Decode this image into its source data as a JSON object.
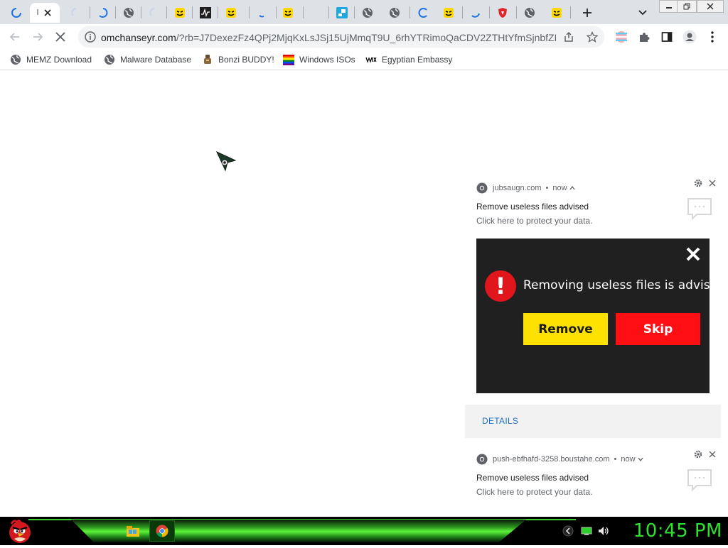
{
  "browser": {
    "url_host": "omchanseyr.com",
    "url_rest": "/?rb=J7DexezFz4QPj2MjqKxLsJSj15UjMmqT9U_6rhYTRimoQaCDV2ZTHtYfmSjnbfZL_...",
    "active_tab_title": "l"
  },
  "bookmarks": [
    {
      "label": "MEMZ Download",
      "icon": "globe-icon"
    },
    {
      "label": "Malware Database",
      "icon": "globe-icon"
    },
    {
      "label": "Bonzi BUDDY!",
      "icon": "bonzi-icon"
    },
    {
      "label": "Windows ISOs",
      "icon": "rainbow-flag-icon"
    },
    {
      "label": "Egyptian Embassy",
      "icon": "wix-icon"
    }
  ],
  "notifications": [
    {
      "origin": "jubsaugn.com",
      "time": "now",
      "title": "Remove useless files advised",
      "body": "Click here to protect your data."
    },
    {
      "origin": "push-ebfhafd-3258.boustahe.com",
      "time": "now",
      "title": "Remove useless files advised",
      "body": "Click here to protect your data."
    }
  ],
  "alert": {
    "message": "Removing useless files is advised",
    "remove_label": "Remove",
    "skip_label": "Skip",
    "icon": "exclamation-icon",
    "colors": {
      "background": "#202020",
      "remove": "#ffe100",
      "skip": "#ff0e14",
      "icon": "#e0161c"
    }
  },
  "details_label": "DETAILS",
  "taskbar": {
    "clock": "10:45 PM",
    "clock_color": "#30e030"
  }
}
